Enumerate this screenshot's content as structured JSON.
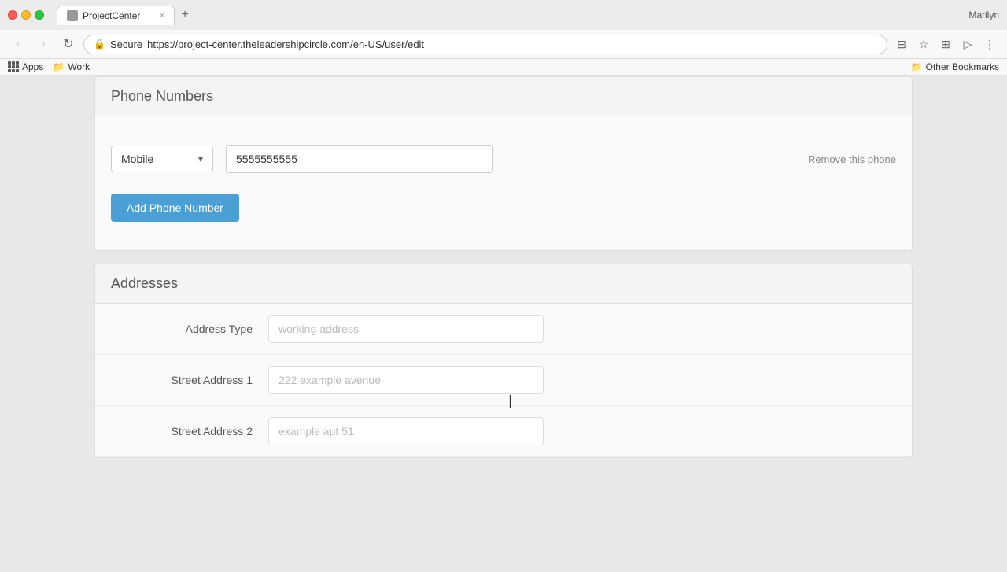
{
  "browser": {
    "tab_title": "ProjectCenter",
    "tab_close": "×",
    "url_secure": "Secure",
    "url": "https://project-center.theleadershipcircle.com/en-US/user/edit",
    "nav_back": "←",
    "nav_forward": "→",
    "nav_reload": "↻",
    "user_name": "Marilyn"
  },
  "bookmarks": {
    "apps_label": "Apps",
    "work_label": "Work",
    "other_label": "Other Bookmarks"
  },
  "phone_section": {
    "title": "Phone Numbers",
    "phone_type": "Mobile",
    "phone_value": "5555555555",
    "phone_placeholder": "",
    "remove_label": "Remove this phone",
    "add_button_label": "Add Phone Number"
  },
  "addresses_section": {
    "title": "Addresses",
    "address_type_label": "Address Type",
    "address_type_placeholder": "working address",
    "street1_label": "Street Address 1",
    "street1_placeholder": "222 example avenue",
    "street2_label": "Street Address 2",
    "street2_placeholder": "example apt 51"
  },
  "icons": {
    "dropdown_arrow": "▾",
    "secure_lock": "🔒",
    "back_arrow": "‹",
    "forward_arrow": "›"
  }
}
